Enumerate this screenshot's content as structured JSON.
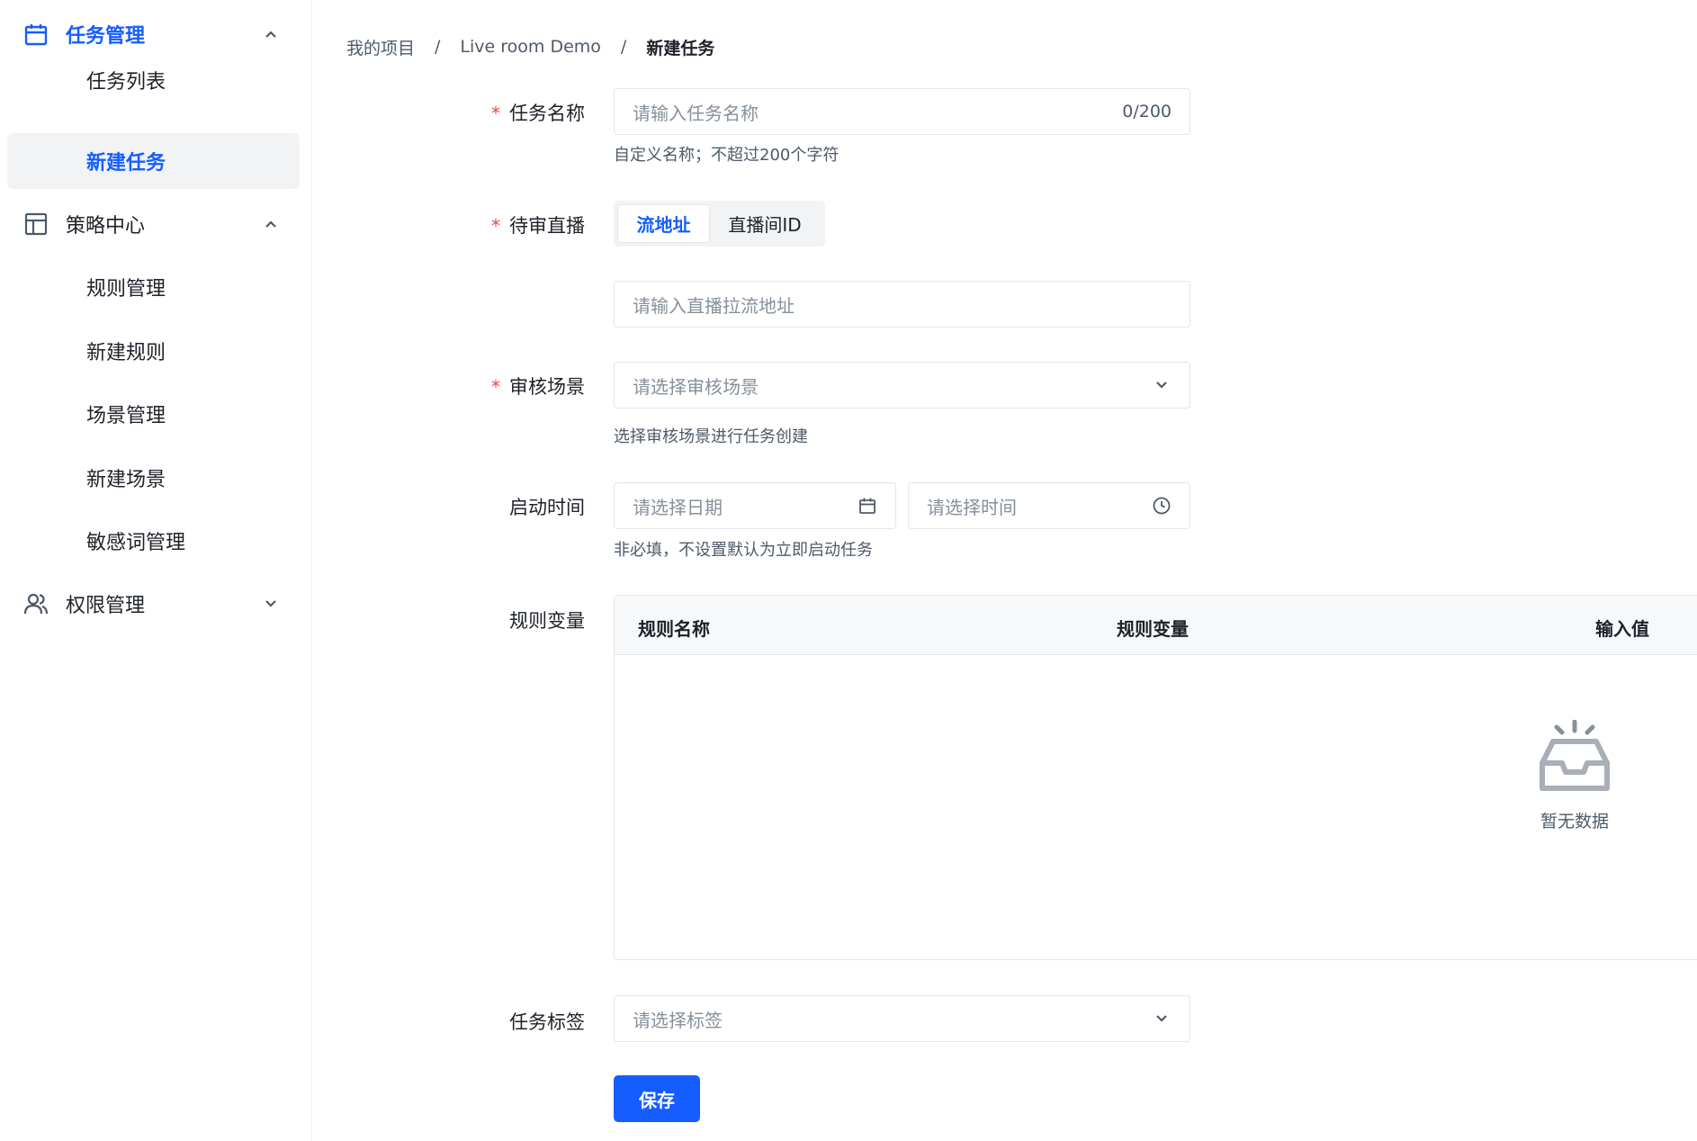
{
  "sidebar": {
    "groups": [
      {
        "label": "任务管理",
        "icon": "calendar-icon",
        "expanded": true,
        "active": true,
        "items": [
          {
            "label": "任务列表"
          },
          {
            "label": "新建任务",
            "selected": true
          }
        ]
      },
      {
        "label": "策略中心",
        "icon": "layout-icon",
        "expanded": true,
        "items": [
          {
            "label": "规则管理"
          },
          {
            "label": "新建规则"
          },
          {
            "label": "场景管理"
          },
          {
            "label": "新建场景"
          },
          {
            "label": "敏感词管理"
          }
        ]
      },
      {
        "label": "权限管理",
        "icon": "users-icon",
        "expanded": false,
        "items": []
      }
    ]
  },
  "breadcrumb": {
    "items": [
      "我的项目",
      "Live room Demo"
    ],
    "current": "新建任务",
    "separator": "/"
  },
  "form": {
    "required_mark": "*",
    "task_name": {
      "label": "任务名称",
      "placeholder": "请输入任务名称",
      "counter": "0/200",
      "hint": "自定义名称；不超过200个字符"
    },
    "live": {
      "label": "待审直播",
      "options": [
        "流地址",
        "直播间ID"
      ],
      "selected": "流地址",
      "placeholder": "请输入直播拉流地址"
    },
    "scene": {
      "label": "审核场景",
      "placeholder": "请选择审核场景",
      "hint": "选择审核场景进行任务创建"
    },
    "start": {
      "label": "启动时间",
      "date_placeholder": "请选择日期",
      "time_placeholder": "请选择时间",
      "hint": "非必填，不设置默认为立即启动任务"
    },
    "rules": {
      "label": "规则变量",
      "columns": [
        "规则名称",
        "规则变量",
        "输入值"
      ],
      "rows": [],
      "empty_text": "暂无数据"
    },
    "tags": {
      "label": "任务标签",
      "placeholder": "请选择标签"
    },
    "save_label": "保存"
  },
  "colors": {
    "primary": "#165dff",
    "required": "#f53f3f",
    "text": "#1d2129",
    "muted": "#4e5969",
    "border": "#e5e6eb"
  }
}
